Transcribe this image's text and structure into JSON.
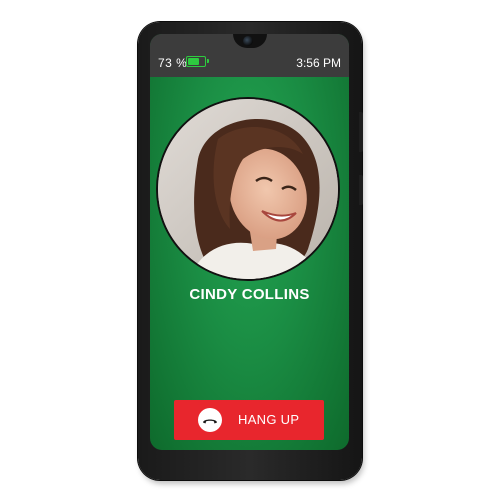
{
  "status_bar": {
    "battery_percent": "73 %",
    "battery_level": 0.73,
    "time": "3:56 PM"
  },
  "call": {
    "caller_name": "CINDY COLLINS",
    "hangup_label": "HANG UP",
    "hangup_icon": "phone-hangup-icon"
  },
  "colors": {
    "screen_green": "#1a8c43",
    "status_bar_bg": "#3c3c3c",
    "hangup_red": "#e8262d",
    "battery_green": "#2ecc40"
  }
}
